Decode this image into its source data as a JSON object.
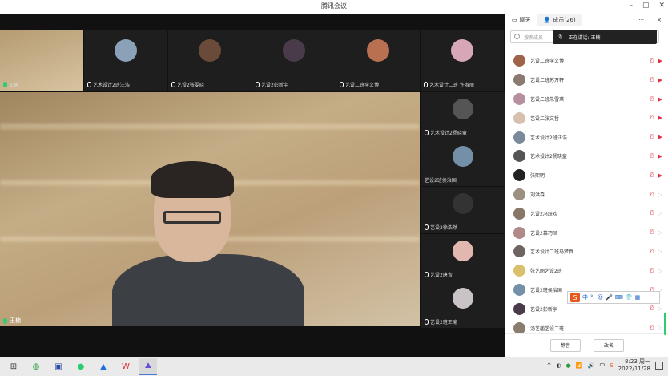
{
  "window": {
    "title": "腾讯会议",
    "controls": [
      "minimize-icon",
      "restore-icon",
      "close-icon"
    ]
  },
  "top_tiles": [
    {
      "name": "王楠",
      "avatar_color": "#c9b28a",
      "mic": "green"
    },
    {
      "name": "艺术设计2班汪浩",
      "avatar_color": "#8aa1b7",
      "mic": "off"
    },
    {
      "name": "艺设2张雯晓",
      "avatar_color": "#6a4b3a",
      "mic": "off"
    },
    {
      "name": "艺设2彭新宇",
      "avatar_color": "#4a3b4a",
      "mic": "off"
    },
    {
      "name": "艺设二班李文博",
      "avatar_color": "#b97050",
      "mic": "off"
    },
    {
      "name": "艺术设计二班 许淑丽",
      "avatar_color": "#d7a7b8",
      "mic": "off"
    }
  ],
  "main_video": {
    "name": "王楠"
  },
  "side_tiles": [
    {
      "name": "艺术设计2杨晓童",
      "avatar_color": "#555555",
      "mic": "off"
    },
    {
      "name": "艺设2班侯治国",
      "avatar_color": "#7390a8",
      "mic": "none"
    },
    {
      "name": "艺设2徐浩然",
      "avatar_color": "#333333",
      "mic": "off"
    },
    {
      "name": "艺设2唐青",
      "avatar_color": "#e2b7b0",
      "mic": "off"
    },
    {
      "name": "艺设2班王瑜",
      "avatar_color": "#c9c2c6",
      "mic": "off"
    }
  ],
  "panel": {
    "tabs": [
      {
        "label": "聊天",
        "icon": "chat-icon"
      },
      {
        "label": "成员(26)",
        "icon": "members-icon"
      }
    ],
    "more": "···",
    "close": "×",
    "search_placeholder": "搜索成员",
    "speaking": "正在讲话: 王楠",
    "members": [
      {
        "name": "艺设二班李文博",
        "color": "#a0624a",
        "video": true
      },
      {
        "name": "艺设二班苏万轩",
        "color": "#8a7a70",
        "video": true
      },
      {
        "name": "艺设二班朱雪琪",
        "color": "#b78fa0",
        "video": true
      },
      {
        "name": "艺设二张文哲",
        "color": "#d8c0b0",
        "video": true
      },
      {
        "name": "艺术设计2班汪浩",
        "color": "#7b8a9a",
        "video": true
      },
      {
        "name": "艺术设计2杨晓童",
        "color": "#555555",
        "video": true
      },
      {
        "name": "张熙明",
        "color": "#222222",
        "video": true
      },
      {
        "name": "刘洪森",
        "color": "#9c9080",
        "video": false
      },
      {
        "name": "艺设2冯跃欢",
        "color": "#887766",
        "video": false
      },
      {
        "name": "艺设2慕巧凤",
        "color": "#b08a88",
        "video": false
      },
      {
        "name": "艺术设计二班马梦真",
        "color": "#6e6460",
        "video": false
      },
      {
        "name": "张艺雨艺设2班",
        "color": "#d9c06a",
        "video": false
      },
      {
        "name": "艺设2班侯治国",
        "color": "#7390a8",
        "video": false
      },
      {
        "name": "艺设2彭新宇",
        "color": "#4a3b4a",
        "video": false
      },
      {
        "name": "汤艺菡艺设二班",
        "color": "#8a7c6e",
        "video": false
      }
    ],
    "mute_all": "静音",
    "rename": "改名"
  },
  "ime": {
    "logo": "S",
    "mode": "中"
  },
  "taskbar": {
    "apps": [
      "windows-start-icon",
      "app-green-icon",
      "app-blue-icon",
      "wechat-icon",
      "tencent-meeting-icon",
      "wps-icon",
      "meeting-active-icon"
    ],
    "time": "8:23 周一",
    "date": "2022/11/28"
  }
}
